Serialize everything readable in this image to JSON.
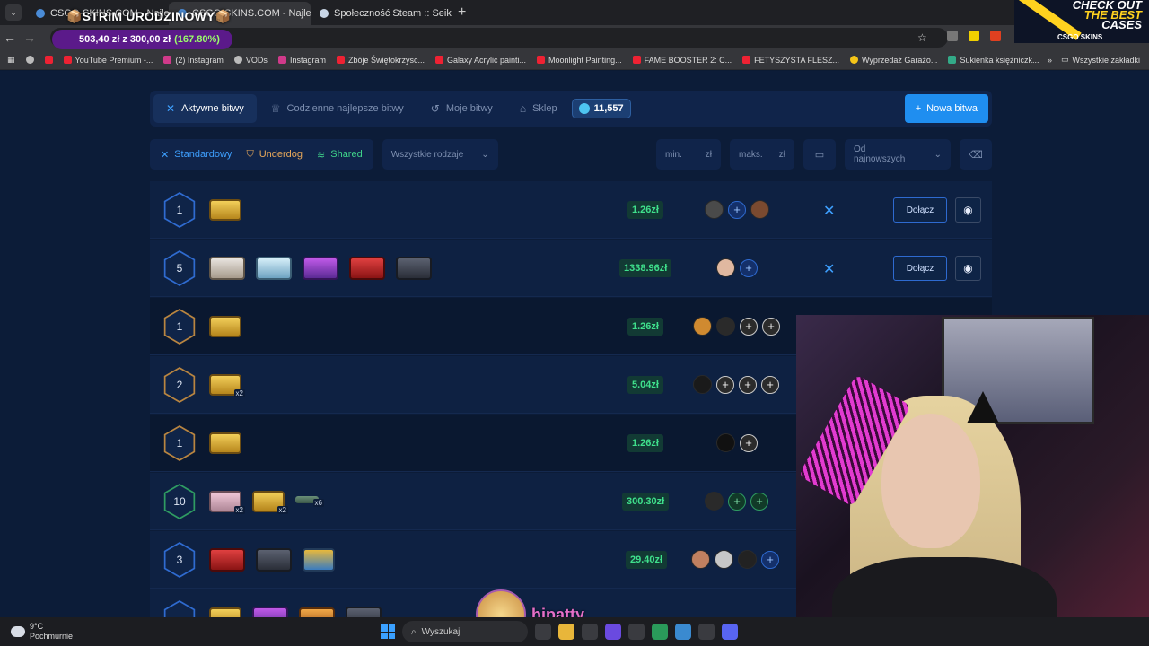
{
  "browser": {
    "tabs": [
      {
        "title": "CSGO-SKINS.COM - Najlepsze",
        "active": false
      },
      {
        "title": "CSGO-SKINS.COM - Najlepsze",
        "active": true
      },
      {
        "title": "Społeczność Steam :: Seiko",
        "active": false
      }
    ],
    "new_tab": "+",
    "bookmarks": [
      {
        "label": "YouTube Premium -...",
        "icon": "youtube-icon"
      },
      {
        "label": "(2) Instagram",
        "icon": "instagram-icon"
      },
      {
        "label": "VODs",
        "icon": "globe-icon"
      },
      {
        "label": "Instagram",
        "icon": "instagram-icon"
      },
      {
        "label": "Zbóje Świętokrzysc...",
        "icon": "youtube-icon"
      },
      {
        "label": "Galaxy Acrylic painti...",
        "icon": "youtube-icon"
      },
      {
        "label": "Moonlight Painting...",
        "icon": "youtube-icon"
      },
      {
        "label": "FAME BOOSTER 2: C...",
        "icon": "youtube-icon"
      },
      {
        "label": "FETYSZYSTA FLESZ...",
        "icon": "youtube-icon"
      },
      {
        "label": "Wyprzedaż Garażo...",
        "icon": "coin-icon"
      },
      {
        "label": "Sukienka księżniczk...",
        "icon": "v-icon"
      }
    ],
    "all_bookmarks": "Wszystkie zakładki"
  },
  "overlay": {
    "strim_title": "STRIM URODZINOWY",
    "goal_text": "503,40 zł z 300,00 zł",
    "goal_percent": "(167.80%)"
  },
  "ad": {
    "line1": "CHECK OUT",
    "line2": "THE BEST",
    "line3": "CASES",
    "brand": "CSGO SKINS"
  },
  "nav": {
    "tabs": [
      {
        "label": "Aktywne bitwy",
        "icon": "swords-icon",
        "active": true
      },
      {
        "label": "Codzienne najlepsze bitwy",
        "icon": "trophy-icon",
        "active": false
      },
      {
        "label": "Moje bitwy",
        "icon": "history-icon",
        "active": false
      },
      {
        "label": "Sklep",
        "icon": "basket-icon",
        "active": false
      }
    ],
    "coins": "11,557",
    "new_battle": "Nowa bitwa"
  },
  "filters": {
    "modes": [
      "Standardowy",
      "Underdog",
      "Shared"
    ],
    "type_select": "Wszystkie rodzaje",
    "min_placeholder": "min.",
    "max_placeholder": "maks.",
    "currency": "zł",
    "sort_select": "Od najnowszych"
  },
  "battles": [
    {
      "rounds": "1",
      "mode": "standard",
      "cases": [
        {
          "style": "gold",
          "qty": ""
        }
      ],
      "price": "1.26zł",
      "slots": [
        "avatar",
        "plus",
        "avatar"
      ],
      "join": "Dołącz"
    },
    {
      "rounds": "5",
      "mode": "standard",
      "cases": [
        {
          "style": "white",
          "qty": ""
        },
        {
          "style": "ice",
          "qty": ""
        },
        {
          "style": "purple",
          "qty": ""
        },
        {
          "style": "red",
          "qty": ""
        },
        {
          "style": "dark",
          "qty": ""
        }
      ],
      "price": "1338.96zł",
      "slots": [
        "avatar",
        "plus"
      ],
      "join": "Dołącz"
    },
    {
      "rounds": "1",
      "mode": "underdog",
      "cases": [
        {
          "style": "gold",
          "qty": ""
        }
      ],
      "price": "1.26zł",
      "slots": [
        "avatar",
        "avatar",
        "plus",
        "plus"
      ],
      "join": ""
    },
    {
      "rounds": "2",
      "mode": "underdog",
      "cases": [
        {
          "style": "gold",
          "qty": "x2"
        }
      ],
      "price": "5.04zł",
      "slots": [
        "avatar",
        "plus",
        "plus",
        "plus"
      ],
      "join": ""
    },
    {
      "rounds": "1",
      "mode": "underdog",
      "cases": [
        {
          "style": "gold",
          "qty": ""
        }
      ],
      "price": "1.26zł",
      "slots": [
        "avatar",
        "plus"
      ],
      "join": ""
    },
    {
      "rounds": "10",
      "mode": "shared",
      "cases": [
        {
          "style": "pink",
          "qty": "x2"
        },
        {
          "style": "gold",
          "qty": "x2"
        },
        {
          "style": "teal",
          "qty": "x6"
        }
      ],
      "price": "300.30zł",
      "slots": [
        "avatar",
        "plus",
        "plus"
      ],
      "join": ""
    },
    {
      "rounds": "3",
      "mode": "standard",
      "cases": [
        {
          "style": "red",
          "qty": ""
        },
        {
          "style": "dark",
          "qty": ""
        },
        {
          "style": "crate",
          "qty": ""
        }
      ],
      "price": "29.40zł",
      "slots": [
        "avatar",
        "avatar",
        "avatar",
        "plus"
      ],
      "join": ""
    }
  ],
  "streamer": {
    "name": "hipatty"
  },
  "taskbar": {
    "temp": "9°C",
    "weather": "Pochmurnie",
    "search": "Wyszukaj"
  }
}
